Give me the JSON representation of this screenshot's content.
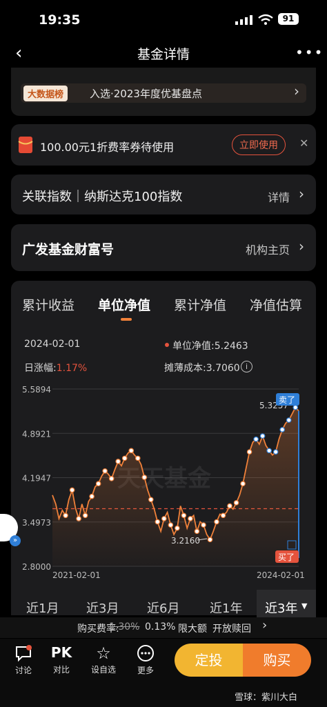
{
  "status": {
    "time": "19:35",
    "battery": "91"
  },
  "nav": {
    "title": "基金详情",
    "back_icon": "back-arrow-icon",
    "more_icon": "more-dots-icon"
  },
  "rank": {
    "badge": "大数据榜",
    "text": "入选·2023年度优基盘点"
  },
  "coupon": {
    "text": "100.00元1折费率券待使用",
    "button": "立即使用"
  },
  "index": {
    "label": "关联指数｜纳斯达克100指数",
    "link": "详情"
  },
  "company": {
    "name": "广发基金财富号",
    "link": "机构主页"
  },
  "tabs": [
    "累计收益",
    "单位净值",
    "累计净值",
    "净值估算"
  ],
  "info": {
    "date": "2024-02-01",
    "nav_label": "单位净值:",
    "nav_value": "5.2463",
    "change_label": "日涨幅:",
    "change_value": "1.17%",
    "cost_label": "摊薄成本:",
    "cost_value": "3.7060"
  },
  "chart_data": {
    "type": "line",
    "y_ticks": [
      "5.5894",
      "4.8921",
      "4.1947",
      "3.4973",
      "2.8000"
    ],
    "ylim": [
      2.8,
      5.5894
    ],
    "x_ticks": [
      "2021-02-01",
      "2024-02-01"
    ],
    "cost_line": 3.706,
    "max_label": "5.3257",
    "min_label": "3.2160",
    "sell_tag": "卖了",
    "buy_tag": "买了",
    "watermark": "天天基金",
    "series": [
      {
        "values": [
          3.92,
          3.78,
          3.55,
          3.68,
          3.6,
          3.85,
          4.0,
          3.72,
          3.55,
          3.78,
          3.6,
          3.82,
          3.9,
          4.05,
          4.1,
          4.22,
          4.3,
          4.25,
          4.18,
          4.32,
          4.45,
          4.38,
          4.5,
          4.58,
          4.62,
          4.55,
          4.5,
          4.4,
          4.2,
          4.0,
          3.85,
          3.7,
          3.5,
          3.35,
          3.55,
          3.65,
          3.45,
          3.3,
          3.4,
          3.75,
          3.6,
          3.4,
          3.55,
          3.6,
          3.35,
          3.5,
          3.45,
          3.3,
          3.22,
          3.35,
          3.5,
          3.62,
          3.6,
          3.65,
          3.75,
          3.7,
          3.8,
          3.92,
          4.1,
          4.35,
          4.6,
          4.75,
          4.8,
          4.72,
          4.85,
          4.7,
          4.62,
          4.55,
          4.6,
          4.8,
          4.95,
          5.05,
          5.1,
          5.2,
          5.3,
          5.2463
        ]
      }
    ]
  },
  "periods": [
    "近1月",
    "近3月",
    "近6月",
    "近1年",
    "近3年"
  ],
  "fee": {
    "label": "购买费率:",
    "original": "1.30%",
    "discounted": "0.13%",
    "limit": "限大额",
    "status": "开放赎回"
  },
  "bottom": {
    "items": [
      {
        "label": "讨论",
        "icon": "chat-bubble-icon"
      },
      {
        "label": "对比",
        "icon": "pk-icon",
        "glyph": "PK"
      },
      {
        "label": "设自选",
        "icon": "star-icon"
      },
      {
        "label": "更多",
        "icon": "more-circle-icon"
      }
    ],
    "dingtou": "定投",
    "buy": "购买",
    "watermark": "雪球：紫川大白"
  },
  "colors": {
    "accent": "#f0813a",
    "red": "#e5533d",
    "blue": "#2f7fd8",
    "dingtou": "#f2b531",
    "buy": "#f07c2c"
  }
}
